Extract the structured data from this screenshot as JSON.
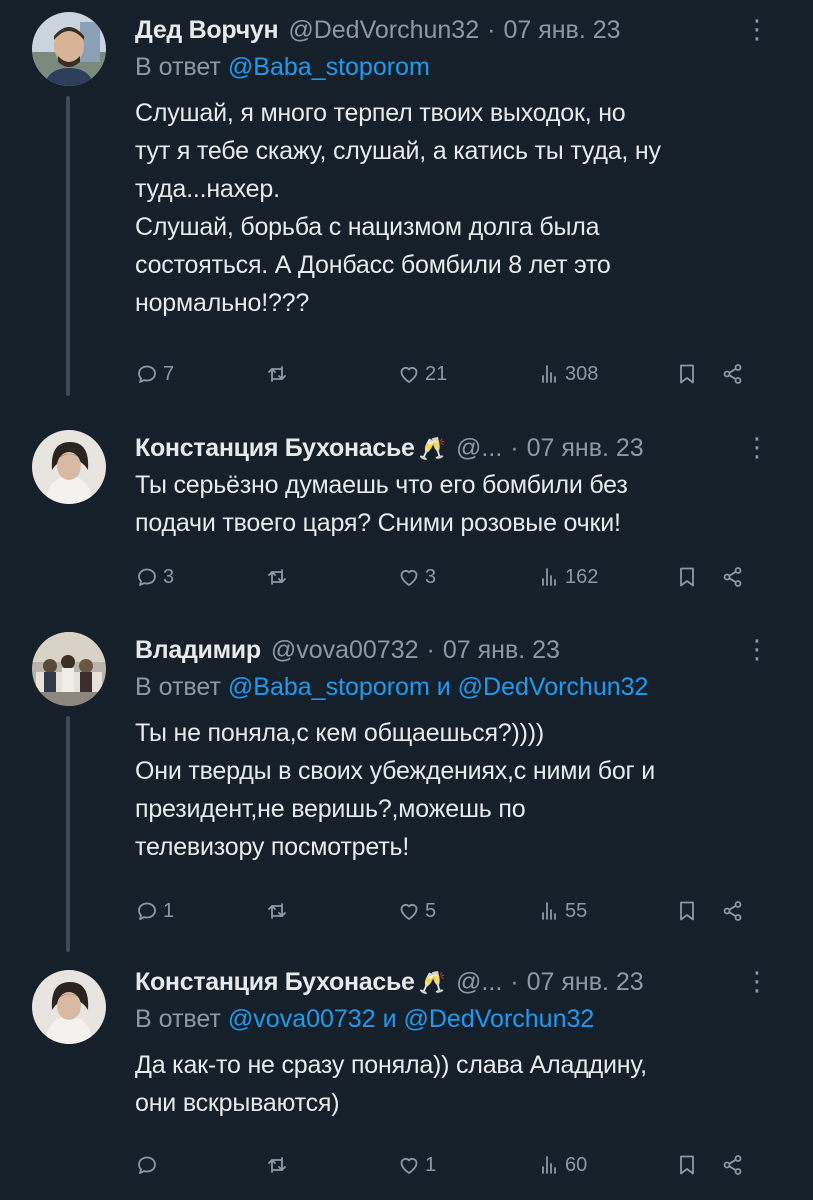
{
  "tweets": [
    {
      "name": "Дед Ворчун",
      "emoji": "",
      "handle": "@DedVorchun32",
      "date": "07 янв. 23",
      "reply_prefix": "В ответ",
      "mentions": [
        "@Baba_stoporom"
      ],
      "mention_joiner": "",
      "text": "Слушай, я много терпел твоих выходок, но\nтут я тебе скажу, слушай, а катись ты туда, ну\nтуда...нахер.\nСлушай, борьба с нацизмом долга была\nсостояться. А Донбасс бомбили 8 лет это\nнормально!???",
      "replies": "7",
      "retweets": "",
      "likes": "21",
      "views": "308"
    },
    {
      "name": "Констанция Бухонасье",
      "emoji": "🥂",
      "handle": "@...",
      "date": "07 янв. 23",
      "reply_prefix": "",
      "mentions": [],
      "mention_joiner": "",
      "text": "Ты серьёзно думаешь что его бомбили без\nподачи твоего царя? Сними розовые очки!",
      "replies": "3",
      "retweets": "",
      "likes": "3",
      "views": "162"
    },
    {
      "name": "Владимир",
      "emoji": "",
      "handle": "@vova00732",
      "date": "07 янв. 23",
      "reply_prefix": "В ответ",
      "mentions": [
        "@Baba_stoporom",
        "@DedVorchun32"
      ],
      "mention_joiner": "и",
      "text": "Ты не поняла,с кем общаешься?))))\nОни тверды в своих убеждениях,с ними бог и\nпрезидент,не веришь?,можешь по\nтелевизору посмотреть!",
      "replies": "1",
      "retweets": "",
      "likes": "5",
      "views": "55"
    },
    {
      "name": "Констанция Бухонасье",
      "emoji": "🥂",
      "handle": "@...",
      "date": "07 янв. 23",
      "reply_prefix": "В ответ",
      "mentions": [
        "@vova00732",
        "@DedVorchun32"
      ],
      "mention_joiner": "и",
      "text": "Да как-то не сразу поняла)) слава Аладдину,\nони вскрываются)",
      "replies": "",
      "retweets": "",
      "likes": "1",
      "views": "60"
    }
  ],
  "ui": {
    "date_separator": "·",
    "more_glyph": "⋮"
  },
  "icons": {
    "reply": "reply-icon",
    "retweet": "retweet-icon",
    "like": "heart-icon",
    "views": "views-icon",
    "bookmark": "bookmark-icon",
    "share": "share-icon",
    "more": "more-icon"
  },
  "colors": {
    "background": "#15202b",
    "text": "#e7e9ea",
    "secondary": "#8b98a5",
    "mention": "#1d9bf0",
    "thread_line": "#3d4a55"
  }
}
